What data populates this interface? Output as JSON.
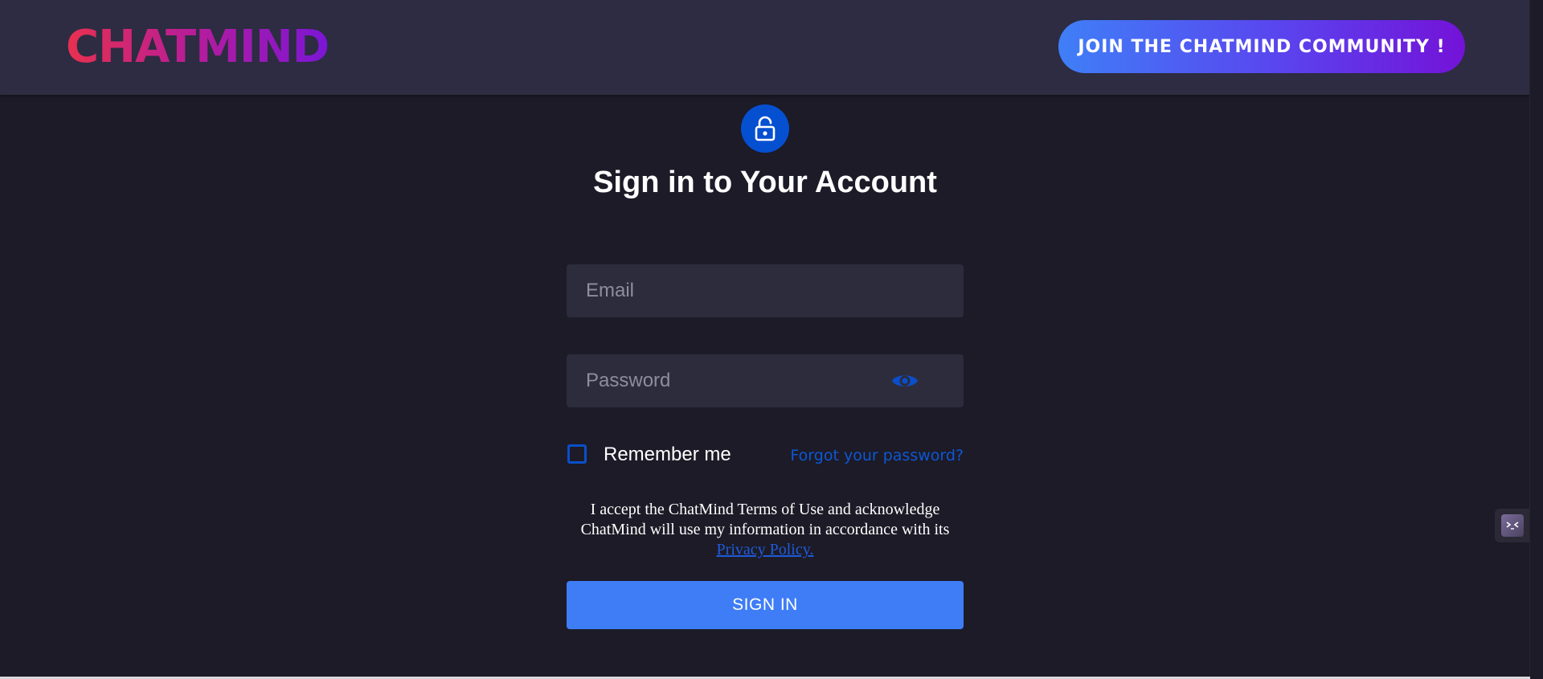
{
  "header": {
    "logo_text": "CHATMIND",
    "join_button_label": "JOIN THE CHATMIND COMMUNITY !"
  },
  "login": {
    "lock_icon": "unlocked-padlock-icon",
    "title": "Sign in to Your Account",
    "email_placeholder": "Email",
    "password_placeholder": "Password",
    "password_toggle_icon": "eye-icon",
    "remember_me_label": "Remember me",
    "remember_me_checked": false,
    "forgot_password_link": "Forgot your password?",
    "terms_text": "I accept the ChatMind Terms of Use and acknowledge ChatMind will use my information in accordance with its ",
    "privacy_link": "Privacy Policy.",
    "sign_in_button_label": "SIGN IN"
  },
  "side_widget": {
    "icon": "assistant-widget-icon"
  },
  "colors": {
    "page_background": "#1c1b27",
    "header_background": "#2d2c42",
    "input_background": "#2d2c3d",
    "accent_blue": "#3e7df6",
    "link_blue": "#0e57d6",
    "lock_circle": "#0550d1",
    "logo_gradient_start": "#e8304f",
    "logo_gradient_end": "#7a16d6",
    "join_gradient_start": "#3f7ff7",
    "join_gradient_end": "#7412d8"
  }
}
